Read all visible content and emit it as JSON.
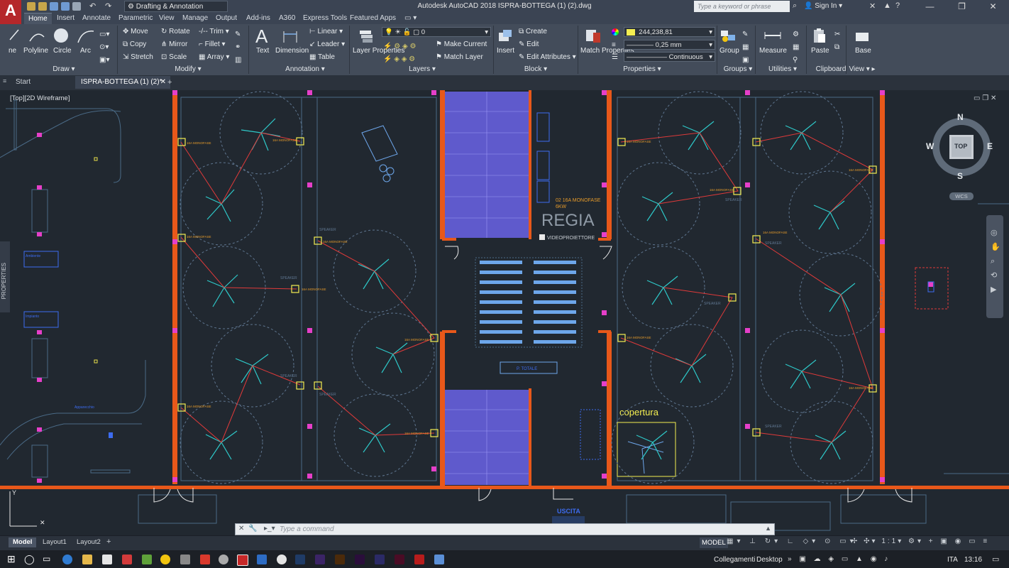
{
  "titlebar": {
    "title": "Autodesk AutoCAD 2018   ISPRA-BOTTEGA (1) (2).dwg",
    "workspace": "Drafting & Annotation",
    "search_placeholder": "Type a keyword or phrase",
    "signin": "Sign In"
  },
  "ribbon_tabs": [
    "Home",
    "Insert",
    "Annotate",
    "Parametric",
    "View",
    "Manage",
    "Output",
    "Add-ins",
    "A360",
    "Express Tools",
    "Featured Apps"
  ],
  "ribbon": {
    "draw": {
      "title": "Draw",
      "line": "ne",
      "polyline": "Polyline",
      "circle": "Circle",
      "arc": "Arc"
    },
    "modify": {
      "title": "Modify",
      "items": [
        "Move",
        "Rotate",
        "Trim",
        "Copy",
        "Mirror",
        "Fillet",
        "Stretch",
        "Scale",
        "Array"
      ]
    },
    "annotation": {
      "title": "Annotation",
      "text": "Text",
      "dimension": "Dimension",
      "linear": "Linear",
      "leader": "Leader",
      "table": "Table"
    },
    "layers": {
      "title": "Layers",
      "layer_properties": "Layer Properties",
      "current_layer": "0",
      "make_current": "Make Current",
      "match_layer": "Match Layer"
    },
    "block": {
      "title": "Block",
      "insert": "Insert",
      "create": "Create",
      "edit": "Edit",
      "edit_attributes": "Edit Attributes"
    },
    "properties": {
      "title": "Properties",
      "match_properties": "Match Properties",
      "color": "244,238,81",
      "lineweight": "0,25 mm",
      "linetype": "Continuous"
    },
    "groups": {
      "title": "Groups",
      "group": "Group"
    },
    "utilities": {
      "title": "Utilities",
      "measure": "Measure"
    },
    "clipboard": {
      "title": "Clipboard",
      "paste": "Paste"
    },
    "view": {
      "title": "View",
      "base": "Base"
    }
  },
  "file_tabs": [
    "Start",
    "ISPRA-BOTTEGA (1) (2)*"
  ],
  "viewport": {
    "label": "[Top][2D Wireframe]",
    "properties_palette": "PROPERTIES",
    "viewcube": {
      "n": "N",
      "s": "S",
      "e": "E",
      "w": "W",
      "top": "TOP",
      "wcs": "WCS"
    }
  },
  "drawing": {
    "regia": "REGIA",
    "regia_note": [
      "02 16A MONOFASE",
      "6KW"
    ],
    "videoproiettore": "VIDEOPROIETTORE",
    "copertura": "copertura",
    "uscita": "USCITA",
    "monofase": "16A MONOFASE",
    "speaker": "SPEAKER"
  },
  "command": {
    "placeholder": "Type a command"
  },
  "layout_tabs": [
    "Model",
    "Layout1",
    "Layout2"
  ],
  "status": {
    "model": "MODEL",
    "scale": "1:1"
  },
  "taskbar": {
    "links": "Collegamenti",
    "desktop": "Desktop",
    "lang": "ITA",
    "time": "13:16"
  },
  "colors": {
    "ribbon": "#434c5a",
    "canvas": "#212830",
    "wall": "#e8581a",
    "seating": "#7b6ef0",
    "fan": "#2ec9c9",
    "wire": "#e03a3a"
  }
}
